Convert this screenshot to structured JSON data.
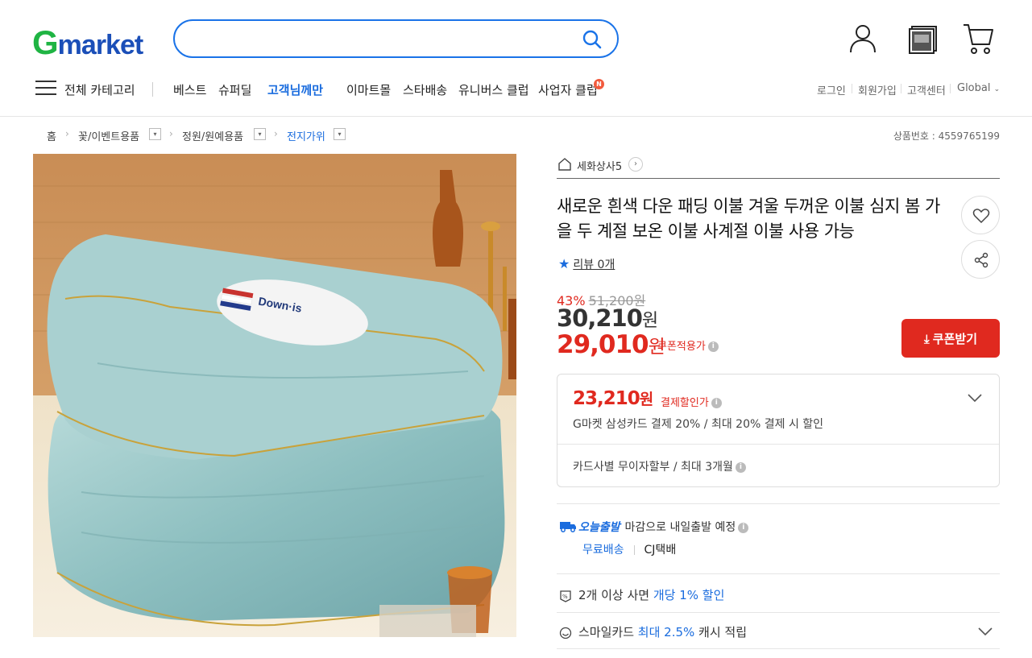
{
  "header": {
    "logo_g": "G",
    "logo_rest": "market",
    "search_placeholder": "",
    "icons": [
      "user-icon",
      "recent-item-icon",
      "cart-icon"
    ]
  },
  "nav": {
    "all_categories": "전체 카테고리",
    "items": [
      "베스트",
      "슈퍼딜",
      "고객님께만",
      "이마트몰",
      "스타배송",
      "유니버스 클럽",
      "사업자 클럽"
    ],
    "new_badge": "N",
    "util": [
      "로그인",
      "회원가입",
      "고객센터",
      "Global"
    ]
  },
  "breadcrumb": {
    "items": [
      "홈",
      "꽃/이벤트용품",
      "정원/원예용품",
      "전지가위"
    ],
    "product_number": "상품번호 : 4559765199"
  },
  "product": {
    "seller": "세화상사5",
    "title": "새로운 흰색 다운 패딩 이불 겨울 두꺼운 이불 심지 봄 가을 두 계절 보온 이불 사계절 이불 사용 가능",
    "review": "리뷰 0개",
    "image_label": "Down·is",
    "discount_pct": "43%",
    "original_price": "51,200원",
    "price": "30,210",
    "coupon_price": "29,010",
    "won": "원",
    "coupon_label": "쿠폰적용가",
    "coupon_button": "쿠폰받기",
    "payment_price": "23,210",
    "payment_label": "결제할인가",
    "payment_desc": "G마켓 삼성카드 결제 20% / 최대 20% 결제 시 할인",
    "installment": "카드사별 무이자할부 / 최대 3개월",
    "shipping_today": "오늘출발",
    "shipping_desc": "마감으로 내일출발 예정",
    "shipping_free": "무료배송",
    "shipping_carrier": "CJ택배",
    "multi_buy_prefix": "2개 이상 사면 ",
    "multi_buy_highlight": "개당 1% 할인",
    "smile_prefix": "스마일카드 ",
    "smile_highlight": "최대 2.5%",
    "smile_suffix": " 캐시 적립"
  },
  "colors": {
    "brand_green": "#1fb443",
    "brand_blue": "#1b4fb8",
    "accent_blue": "#1a6cde",
    "sale_red": "#e0291f"
  }
}
